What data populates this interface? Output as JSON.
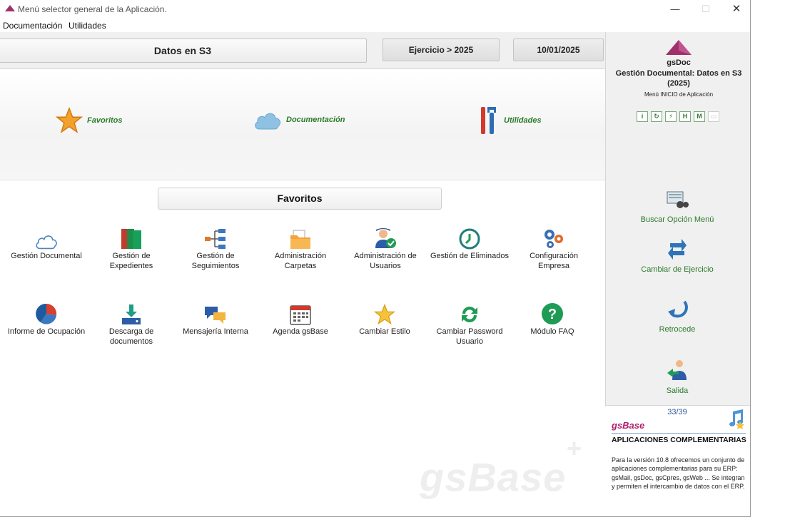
{
  "window": {
    "title": "Menú selector general de la Aplicación."
  },
  "menubar": {
    "items": [
      "Documentación",
      "Utilidades"
    ]
  },
  "topbar": {
    "title": "Datos en S3",
    "ejercicio": "Ejercicio > 2025",
    "date": "10/01/2025"
  },
  "categories": [
    {
      "label": "Favoritos",
      "icon": "star-icon"
    },
    {
      "label": "Documentación",
      "icon": "cloud-icon"
    },
    {
      "label": "Utilidades",
      "icon": "tools-icon"
    }
  ],
  "favorites": {
    "header": "Favoritos",
    "items": [
      {
        "label": "Gestión Documental",
        "icon": "cloud-icon"
      },
      {
        "label": "Gestión de Expedientes",
        "icon": "binders-icon"
      },
      {
        "label": "Gestión de Seguimientos",
        "icon": "hierarchy-icon"
      },
      {
        "label": "Administración Carpetas",
        "icon": "folder-icon"
      },
      {
        "label": "Administración de Usuarios",
        "icon": "user-check-icon"
      },
      {
        "label": "Gestión de Eliminados",
        "icon": "restore-icon"
      },
      {
        "label": "Configuración Empresa",
        "icon": "gears-icon"
      },
      {
        "label": "Informe de Ocupación",
        "icon": "pie-chart-icon"
      },
      {
        "label": "Descarga de documentos",
        "icon": "download-icon"
      },
      {
        "label": "Mensajería Interna",
        "icon": "chat-icon"
      },
      {
        "label": "Agenda gsBase",
        "icon": "calendar-icon"
      },
      {
        "label": "Cambiar Estilo",
        "icon": "star-icon"
      },
      {
        "label": "Cambiar Password Usuario",
        "icon": "refresh-icon"
      },
      {
        "label": "Módulo FAQ",
        "icon": "help-icon"
      }
    ]
  },
  "rightpanel": {
    "app": "gsDoc",
    "subtitle": "Gestión Documental: Datos en S3",
    "year": "(2025)",
    "menu_caption": "Menú INICIO de Aplicación",
    "mini_buttons": [
      "i",
      "↻",
      "⚡",
      "H",
      "M",
      "▭"
    ],
    "actions": [
      {
        "label": "Buscar Opción Menú",
        "icon": "search-menu-icon"
      },
      {
        "label": "Cambiar de Ejercicio",
        "icon": "swap-icon"
      },
      {
        "label": "Retrocede",
        "icon": "back-icon"
      },
      {
        "label": "Salida",
        "icon": "exit-icon"
      }
    ]
  },
  "news": {
    "counter": "33/39",
    "brand": "gsBase",
    "headline": "APLICACIONES COMPLEMENTARIAS",
    "body": "Para la versión 10.8 ofrecemos un conjunto de aplicaciones complementarias para su ERP: gsMail, gsDoc, gsCpres, gsWeb ... Se integran y permiten el intercambio de datos con el ERP."
  },
  "watermark": {
    "text": "gsBase",
    "sup": "+"
  },
  "colors": {
    "accent": "#a0306a",
    "green_text": "#2c7a2c",
    "link_blue": "#2a5aa0"
  }
}
